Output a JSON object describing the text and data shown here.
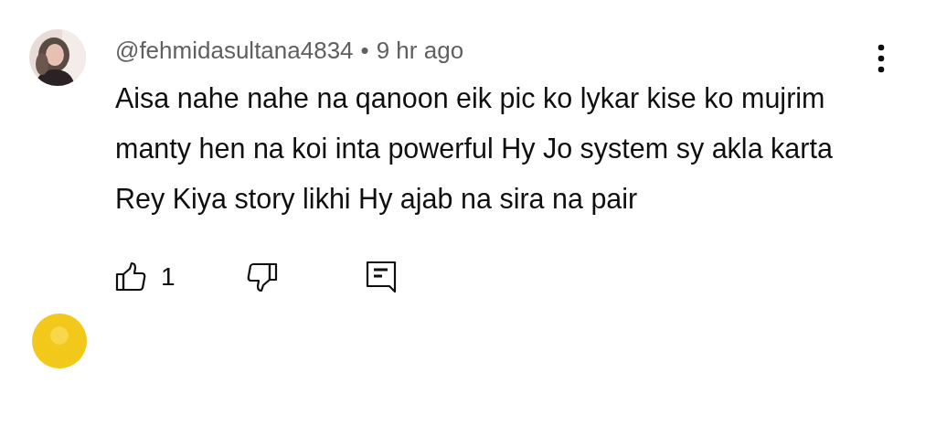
{
  "comment": {
    "author": "@fehmidasultana4834",
    "separator": "•",
    "time": "9 hr ago",
    "text": "Aisa nahe nahe na qanoon eik pic ko lykar kise ko mujrim manty hen na koi inta powerful Hy Jo system sy akla karta Rey Kiya story likhi Hy ajab na sira na pair",
    "like_count": "1"
  }
}
